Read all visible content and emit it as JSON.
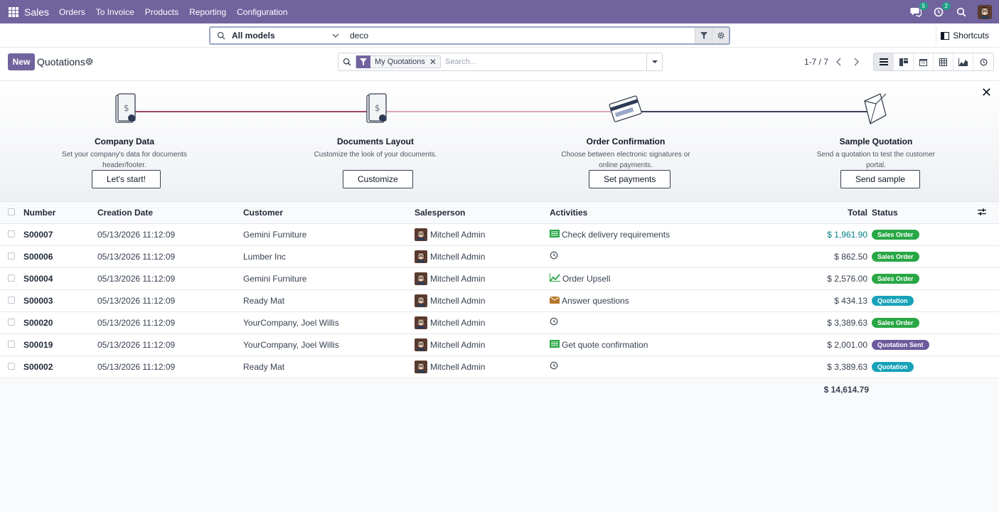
{
  "navbar": {
    "brand": "Sales",
    "menu": [
      "Orders",
      "To Invoice",
      "Products",
      "Reporting",
      "Configuration"
    ],
    "messages_count": "5",
    "activities_count": "2",
    "accent": "#71639e"
  },
  "command": {
    "model": "All models",
    "query": "deco",
    "shortcuts_label": "Shortcuts"
  },
  "control": {
    "new_label": "New",
    "title": "Quotations",
    "facet": "My Quotations",
    "search_placeholder": "Search...",
    "pager": "1-7 / 7"
  },
  "onboarding": {
    "steps": [
      {
        "title": "Company Data",
        "desc": "Set your company's data for documents header/footer.",
        "button": "Let's start!"
      },
      {
        "title": "Documents Layout",
        "desc": "Customize the look of your documents.",
        "button": "Customize"
      },
      {
        "title": "Order Confirmation",
        "desc": "Choose between electronic signatures or online payments.",
        "button": "Set payments"
      },
      {
        "title": "Sample Quotation",
        "desc": "Send a quotation to test the customer portal.",
        "button": "Send sample"
      }
    ]
  },
  "table": {
    "headers": {
      "number": "Number",
      "date": "Creation Date",
      "customer": "Customer",
      "salesperson": "Salesperson",
      "activities": "Activities",
      "total": "Total",
      "status": "Status"
    },
    "rows": [
      {
        "number": "S00007",
        "date": "05/13/2026 11:12:09",
        "customer": "Gemini Furniture",
        "salesperson": "Mitchell Admin",
        "activity": "Check delivery requirements",
        "activity_icon": "todo-icon",
        "total": "$ 1,961.90",
        "total_link": true,
        "status": "Sales Order",
        "status_color": "#28a745"
      },
      {
        "number": "S00006",
        "date": "05/13/2026 11:12:09",
        "customer": "Lumber Inc",
        "salesperson": "Mitchell Admin",
        "activity": "",
        "activity_icon": "clock-icon",
        "total": "$ 862.50",
        "total_link": false,
        "status": "Sales Order",
        "status_color": "#28a745"
      },
      {
        "number": "S00004",
        "date": "05/13/2026 11:12:09",
        "customer": "Gemini Furniture",
        "salesperson": "Mitchell Admin",
        "activity": "Order Upsell",
        "activity_icon": "chart-icon",
        "total": "$ 2,576.00",
        "total_link": false,
        "status": "Sales Order",
        "status_color": "#28a745"
      },
      {
        "number": "S00003",
        "date": "05/13/2026 11:12:09",
        "customer": "Ready Mat",
        "salesperson": "Mitchell Admin",
        "activity": "Answer questions",
        "activity_icon": "email-icon",
        "total": "$ 434.13",
        "total_link": false,
        "status": "Quotation",
        "status_color": "#17a2b8"
      },
      {
        "number": "S00020",
        "date": "05/13/2026 11:12:09",
        "customer": "YourCompany, Joel Willis",
        "salesperson": "Mitchell Admin",
        "activity": "",
        "activity_icon": "clock-icon",
        "total": "$ 3,389.63",
        "total_link": false,
        "status": "Sales Order",
        "status_color": "#28a745"
      },
      {
        "number": "S00019",
        "date": "05/13/2026 11:12:09",
        "customer": "YourCompany, Joel Willis",
        "salesperson": "Mitchell Admin",
        "activity": "Get quote confirmation",
        "activity_icon": "todo-icon",
        "total": "$ 2,001.00",
        "total_link": false,
        "status": "Quotation Sent",
        "status_color": "#6d5a9c"
      },
      {
        "number": "S00002",
        "date": "05/13/2026 11:12:09",
        "customer": "Ready Mat",
        "salesperson": "Mitchell Admin",
        "activity": "",
        "activity_icon": "clock-icon",
        "total": "$ 3,389.63",
        "total_link": false,
        "status": "Quotation",
        "status_color": "#17a2b8"
      }
    ],
    "grand_total": "$ 14,614.79"
  }
}
